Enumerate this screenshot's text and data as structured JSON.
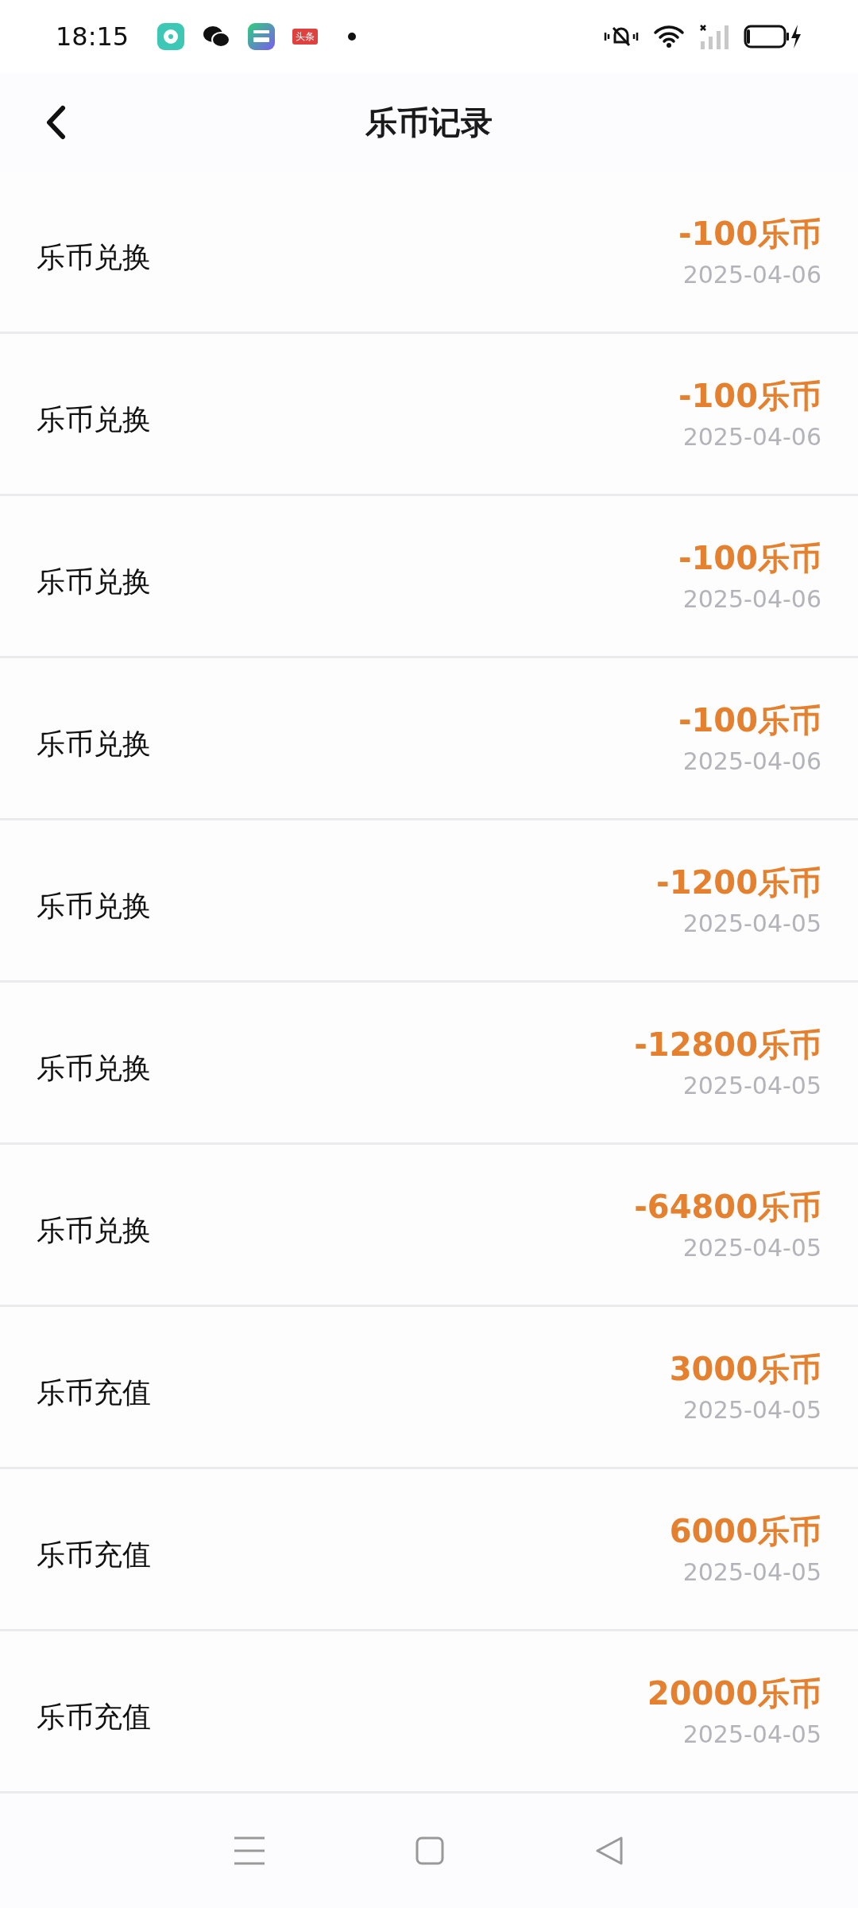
{
  "status_bar": {
    "time": "18:15",
    "badge_text": "头条"
  },
  "header": {
    "title": "乐币记录"
  },
  "records": [
    {
      "label": "乐币兑换",
      "amount": "-100乐币",
      "date": "2025-04-06"
    },
    {
      "label": "乐币兑换",
      "amount": "-100乐币",
      "date": "2025-04-06"
    },
    {
      "label": "乐币兑换",
      "amount": "-100乐币",
      "date": "2025-04-06"
    },
    {
      "label": "乐币兑换",
      "amount": "-100乐币",
      "date": "2025-04-06"
    },
    {
      "label": "乐币兑换",
      "amount": "-1200乐币",
      "date": "2025-04-05"
    },
    {
      "label": "乐币兑换",
      "amount": "-12800乐币",
      "date": "2025-04-05"
    },
    {
      "label": "乐币兑换",
      "amount": "-64800乐币",
      "date": "2025-04-05"
    },
    {
      "label": "乐币充值",
      "amount": "3000乐币",
      "date": "2025-04-05"
    },
    {
      "label": "乐币充值",
      "amount": "6000乐币",
      "date": "2025-04-05"
    },
    {
      "label": "乐币充值",
      "amount": "20000乐币",
      "date": "2025-04-05"
    }
  ]
}
